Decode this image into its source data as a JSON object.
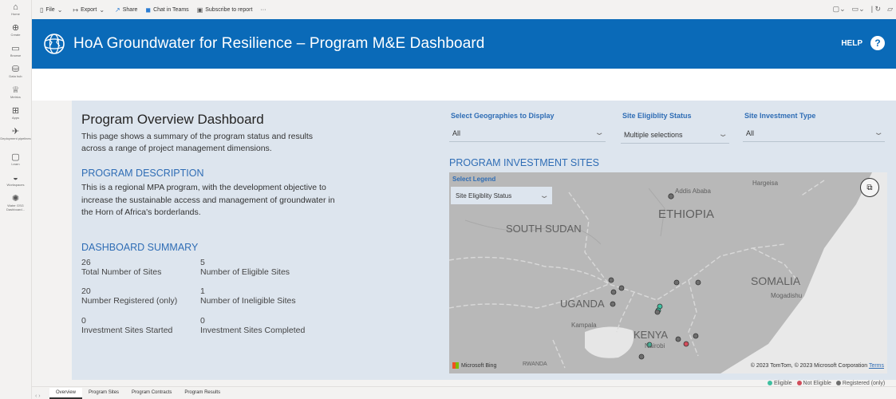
{
  "rail": [
    {
      "icon": "⌂",
      "label": "Home",
      "name": "home"
    },
    {
      "icon": "⊕",
      "label": "Create",
      "name": "create"
    },
    {
      "icon": "▭",
      "label": "Browse",
      "name": "browse"
    },
    {
      "icon": "⛁",
      "label": "Data hub",
      "name": "data-hub"
    },
    {
      "icon": "♕",
      "label": "Metrics",
      "name": "metrics"
    },
    {
      "icon": "⊞",
      "label": "Apps",
      "name": "apps"
    },
    {
      "icon": "✈",
      "label": "Deployment pipelines",
      "name": "deployment-pipelines"
    },
    {
      "icon": "▢",
      "label": "Learn",
      "name": "learn"
    },
    {
      "icon": "◒",
      "label": "Workspaces",
      "name": "workspaces"
    },
    {
      "icon": "✺",
      "label": "Water GSG Dashboard...",
      "name": "water-gsg-dashboard"
    }
  ],
  "toolbar": {
    "file": "File",
    "export": "Export",
    "share": "Share",
    "teams": "Chat in Teams",
    "subscribe": "Subscribe to report",
    "more": "···"
  },
  "banner": {
    "title": "HoA Groundwater for Resilience – Program M&E Dashboard",
    "help": "HELP",
    "help_icon": "?"
  },
  "overview": {
    "title": "Program Overview Dashboard",
    "description": "This page shows a summary of the program status and results across a range of project management dimensions.",
    "program_heading": "PROGRAM DESCRIPTION",
    "program_text": "This is a regional MPA program, with the development objective to increase the sustainable access and management of groundwater in the Horn of Africa's borderlands.",
    "summary_heading": "DASHBOARD SUMMARY"
  },
  "stats": [
    {
      "value": "26",
      "label": "Total Number of Sites"
    },
    {
      "value": "5",
      "label": "Number of Eligible Sites"
    },
    {
      "value": "20",
      "label": "Number Registered (only)"
    },
    {
      "value": "1",
      "label": "Number of Ineligible Sites"
    },
    {
      "value": "0",
      "label": "Investment Sites Started"
    },
    {
      "value": "0",
      "label": "Investment Sites Completed"
    }
  ],
  "filters": {
    "geo_label": "Select Geographies to Display",
    "geo_value": "All",
    "elig_label": "Site Eligiblity Status",
    "elig_value": "Multiple selections",
    "invest_label": "Site Investment Type",
    "invest_value": "All"
  },
  "map": {
    "title": "PROGRAM INVESTMENT SITES",
    "legend_label": "Select Legend",
    "legend_value": "Site Eligiblity Status",
    "labels": {
      "addis": "Addis Ababa",
      "hargeisa": "Hargeisa",
      "ethiopia": "ETHIOPIA",
      "south_sudan": "SOUTH SUDAN",
      "somalia": "SOMALIA",
      "mogadishu": "Mogadishu",
      "uganda": "UGANDA",
      "kampala": "Kampala",
      "kenya": "KENYA",
      "nairobi": "Nairobi",
      "rwanda": "RWANDA"
    },
    "bing": "Microsoft Bing",
    "copyright": "© 2023 TomTom, © 2023 Microsoft Corporation",
    "terms": "Terms",
    "legend_bottom": [
      "Eligible",
      "Not Eligible",
      "Registered (only)"
    ],
    "colors": {
      "eligible": "#3fbfa0",
      "not_eligible": "#d14d5b",
      "registered": "#6e6e6e"
    }
  },
  "tabs": [
    "Overview",
    "Program Sites",
    "Program Contracts",
    "Program Results"
  ]
}
